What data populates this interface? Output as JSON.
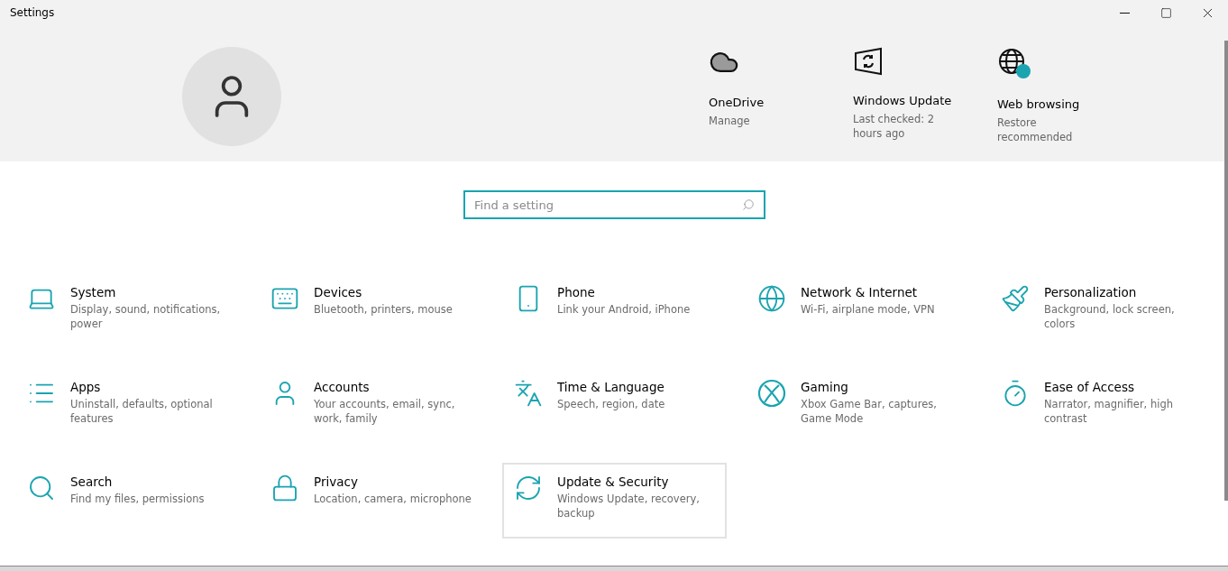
{
  "window": {
    "title": "Settings"
  },
  "header": {
    "shortcuts": [
      {
        "kind": "cloud",
        "title": "OneDrive",
        "subtitle": "Manage"
      },
      {
        "kind": "update",
        "title": "Windows Update",
        "subtitle": "Last checked: 2 hours ago"
      },
      {
        "kind": "browser",
        "title": "Web browsing",
        "subtitle": "Restore recommended"
      }
    ]
  },
  "search": {
    "placeholder": "Find a setting"
  },
  "categories": [
    {
      "kind": "system",
      "title": "System",
      "description": "Display, sound, notifications, power",
      "selected": false
    },
    {
      "kind": "devices",
      "title": "Devices",
      "description": "Bluetooth, printers, mouse",
      "selected": false
    },
    {
      "kind": "phone",
      "title": "Phone",
      "description": "Link your Android, iPhone",
      "selected": false
    },
    {
      "kind": "network",
      "title": "Network & Internet",
      "description": "Wi-Fi, airplane mode, VPN",
      "selected": false
    },
    {
      "kind": "personalization",
      "title": "Personalization",
      "description": "Background, lock screen, colors",
      "selected": false
    },
    {
      "kind": "apps",
      "title": "Apps",
      "description": "Uninstall, defaults, optional features",
      "selected": false
    },
    {
      "kind": "accounts",
      "title": "Accounts",
      "description": "Your accounts, email, sync, work, family",
      "selected": false
    },
    {
      "kind": "time",
      "title": "Time & Language",
      "description": "Speech, region, date",
      "selected": false
    },
    {
      "kind": "gaming",
      "title": "Gaming",
      "description": "Xbox Game Bar, captures, Game Mode",
      "selected": false
    },
    {
      "kind": "ease",
      "title": "Ease of Access",
      "description": "Narrator, magnifier, high contrast",
      "selected": false
    },
    {
      "kind": "search",
      "title": "Search",
      "description": "Find my files, permissions",
      "selected": false
    },
    {
      "kind": "privacy",
      "title": "Privacy",
      "description": "Location, camera, microphone",
      "selected": false
    },
    {
      "kind": "update",
      "title": "Update & Security",
      "description": "Windows Update, recovery, backup",
      "selected": true
    }
  ]
}
